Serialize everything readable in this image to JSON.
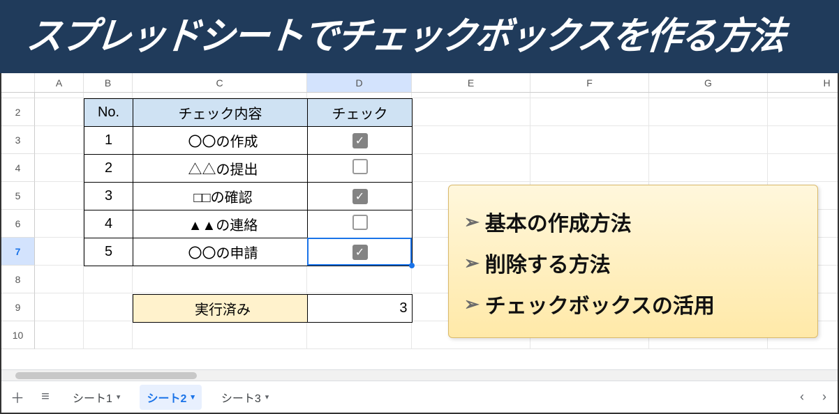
{
  "banner_title": "スプレッドシートでチェックボックスを作る方法",
  "columns": [
    "A",
    "B",
    "C",
    "D",
    "E",
    "F",
    "G",
    "H"
  ],
  "row_numbers": [
    "2",
    "3",
    "4",
    "5",
    "6",
    "7",
    "8",
    "9",
    "10"
  ],
  "selected_column": "D",
  "selected_row": "7",
  "table": {
    "headers": {
      "no": "No.",
      "body": "チェック内容",
      "chk": "チェック"
    },
    "rows": [
      {
        "no": "1",
        "body": "〇〇の作成",
        "checked": true
      },
      {
        "no": "2",
        "body": "△△の提出",
        "checked": false
      },
      {
        "no": "3",
        "body": "□□の確認",
        "checked": true
      },
      {
        "no": "4",
        "body": "▲▲の連絡",
        "checked": false
      },
      {
        "no": "5",
        "body": "〇〇の申請",
        "checked": true
      }
    ],
    "summary_label": "実行済み",
    "summary_value": "3"
  },
  "callout": {
    "items": [
      "基本の作成方法",
      "削除する方法",
      "チェックボックスの活用"
    ]
  },
  "tabs": {
    "items": [
      {
        "label": "シート1",
        "active": false
      },
      {
        "label": "シート2",
        "active": true
      },
      {
        "label": "シート3",
        "active": false
      }
    ]
  },
  "icons": {
    "check": "✓",
    "chevron": "➢",
    "plus": "＋",
    "menu": "≡",
    "dd": "▾",
    "left": "‹",
    "right": "›"
  }
}
